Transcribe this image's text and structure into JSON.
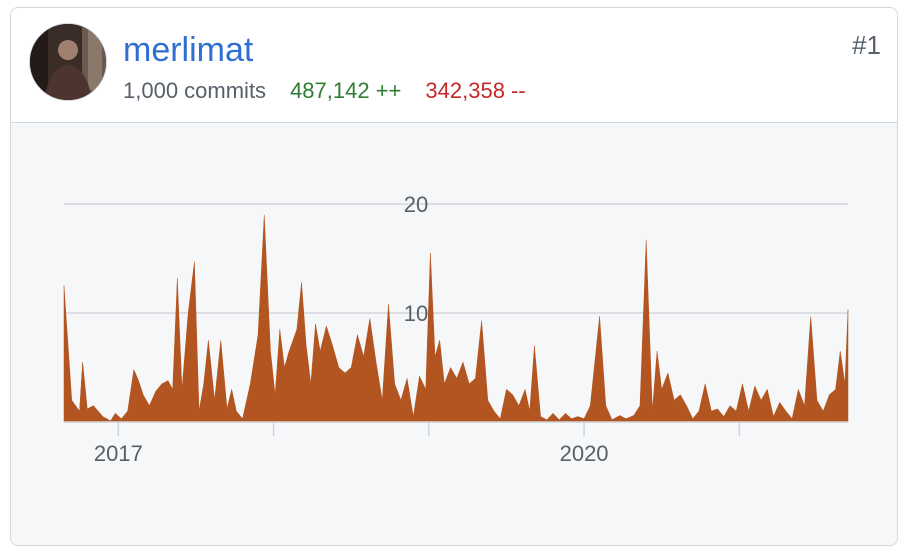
{
  "contributor": {
    "username": "merlimat",
    "rank": "#1",
    "commits": "1,000 commits",
    "additions": "487,142 ++",
    "deletions": "342,358 --"
  },
  "colors": {
    "area": "#b25521",
    "username": "#2f6fd1",
    "additions": "#2f7d32",
    "deletions": "#c62828"
  },
  "chart_data": {
    "type": "area",
    "title": "",
    "xlabel": "",
    "ylabel": "",
    "grid": true,
    "ylim": [
      0,
      20
    ],
    "xlim": [
      2016.55,
      2021.6
    ],
    "x_ticks": [
      2016.9,
      2017.9,
      2018.9,
      2019.9,
      2020.9
    ],
    "x_tick_labels": [
      {
        "x": 2016.9,
        "label": "2017"
      },
      {
        "x": 2019.9,
        "label": "2020"
      }
    ],
    "y_ticks": [
      10,
      20
    ],
    "series": [
      {
        "values": [
          [
            2016.55,
            12.5
          ],
          [
            2016.6,
            2
          ],
          [
            2016.65,
            1
          ],
          [
            2016.67,
            5.5
          ],
          [
            2016.7,
            1.2
          ],
          [
            2016.74,
            1.5
          ],
          [
            2016.8,
            0.5
          ],
          [
            2016.85,
            0.1
          ],
          [
            2016.88,
            0.8
          ],
          [
            2016.92,
            0.3
          ],
          [
            2016.96,
            1
          ],
          [
            2017.0,
            4.8
          ],
          [
            2017.03,
            3.8
          ],
          [
            2017.06,
            2.5
          ],
          [
            2017.1,
            1.5
          ],
          [
            2017.14,
            2.8
          ],
          [
            2017.18,
            3.5
          ],
          [
            2017.22,
            3.8
          ],
          [
            2017.25,
            3
          ],
          [
            2017.28,
            13.2
          ],
          [
            2017.31,
            3
          ],
          [
            2017.35,
            10
          ],
          [
            2017.39,
            14.7
          ],
          [
            2017.42,
            1
          ],
          [
            2017.45,
            3.5
          ],
          [
            2017.48,
            7.5
          ],
          [
            2017.52,
            2
          ],
          [
            2017.56,
            7.5
          ],
          [
            2017.6,
            1.2
          ],
          [
            2017.63,
            3
          ],
          [
            2017.66,
            1
          ],
          [
            2017.7,
            0.3
          ],
          [
            2017.75,
            3.5
          ],
          [
            2017.8,
            8
          ],
          [
            2017.84,
            19
          ],
          [
            2017.88,
            6.5
          ],
          [
            2017.91,
            2.5
          ],
          [
            2017.94,
            8.5
          ],
          [
            2017.97,
            5
          ],
          [
            2018.0,
            6.5
          ],
          [
            2018.05,
            8.5
          ],
          [
            2018.08,
            12.8
          ],
          [
            2018.11,
            7
          ],
          [
            2018.14,
            3.5
          ],
          [
            2018.17,
            9
          ],
          [
            2018.2,
            6.5
          ],
          [
            2018.24,
            8.8
          ],
          [
            2018.28,
            7
          ],
          [
            2018.32,
            5
          ],
          [
            2018.36,
            4.5
          ],
          [
            2018.4,
            5
          ],
          [
            2018.44,
            8
          ],
          [
            2018.48,
            6
          ],
          [
            2018.52,
            9.5
          ],
          [
            2018.56,
            5.5
          ],
          [
            2018.6,
            2
          ],
          [
            2018.64,
            10.8
          ],
          [
            2018.68,
            3.5
          ],
          [
            2018.72,
            2
          ],
          [
            2018.76,
            4
          ],
          [
            2018.8,
            0.5
          ],
          [
            2018.84,
            4.2
          ],
          [
            2018.88,
            3
          ],
          [
            2018.91,
            15.5
          ],
          [
            2018.94,
            6
          ],
          [
            2018.97,
            7.5
          ],
          [
            2019.0,
            3.5
          ],
          [
            2019.04,
            5
          ],
          [
            2019.08,
            4
          ],
          [
            2019.12,
            5.5
          ],
          [
            2019.16,
            3.5
          ],
          [
            2019.2,
            4
          ],
          [
            2019.24,
            9.3
          ],
          [
            2019.28,
            2
          ],
          [
            2019.32,
            1
          ],
          [
            2019.36,
            0.3
          ],
          [
            2019.4,
            3
          ],
          [
            2019.44,
            2.5
          ],
          [
            2019.48,
            1.5
          ],
          [
            2019.52,
            3
          ],
          [
            2019.55,
            1
          ],
          [
            2019.58,
            7
          ],
          [
            2019.62,
            0.5
          ],
          [
            2019.66,
            0.2
          ],
          [
            2019.7,
            0.8
          ],
          [
            2019.74,
            0.2
          ],
          [
            2019.78,
            0.8
          ],
          [
            2019.82,
            0.3
          ],
          [
            2019.86,
            0.5
          ],
          [
            2019.9,
            0.3
          ],
          [
            2019.94,
            1.5
          ],
          [
            2020.0,
            9.7
          ],
          [
            2020.04,
            1.5
          ],
          [
            2020.08,
            0.2
          ],
          [
            2020.13,
            0.6
          ],
          [
            2020.17,
            0.3
          ],
          [
            2020.22,
            0.6
          ],
          [
            2020.26,
            1.5
          ],
          [
            2020.3,
            16.7
          ],
          [
            2020.34,
            1
          ],
          [
            2020.37,
            6.5
          ],
          [
            2020.4,
            3
          ],
          [
            2020.44,
            4.5
          ],
          [
            2020.48,
            2
          ],
          [
            2020.52,
            2.5
          ],
          [
            2020.56,
            1.5
          ],
          [
            2020.6,
            0.3
          ],
          [
            2020.64,
            1
          ],
          [
            2020.68,
            3.5
          ],
          [
            2020.72,
            1
          ],
          [
            2020.76,
            1.2
          ],
          [
            2020.8,
            0.5
          ],
          [
            2020.84,
            1.5
          ],
          [
            2020.88,
            1
          ],
          [
            2020.92,
            3.5
          ],
          [
            2020.96,
            1
          ],
          [
            2021.0,
            3.3
          ],
          [
            2021.04,
            2
          ],
          [
            2021.08,
            3
          ],
          [
            2021.12,
            0.5
          ],
          [
            2021.16,
            1.8
          ],
          [
            2021.2,
            1
          ],
          [
            2021.24,
            0.3
          ],
          [
            2021.28,
            3
          ],
          [
            2021.32,
            1.5
          ],
          [
            2021.36,
            9.7
          ],
          [
            2021.4,
            2
          ],
          [
            2021.44,
            1
          ],
          [
            2021.48,
            2.5
          ],
          [
            2021.52,
            3
          ],
          [
            2021.55,
            6.5
          ],
          [
            2021.58,
            3.5
          ],
          [
            2021.6,
            10.3
          ]
        ]
      }
    ]
  }
}
